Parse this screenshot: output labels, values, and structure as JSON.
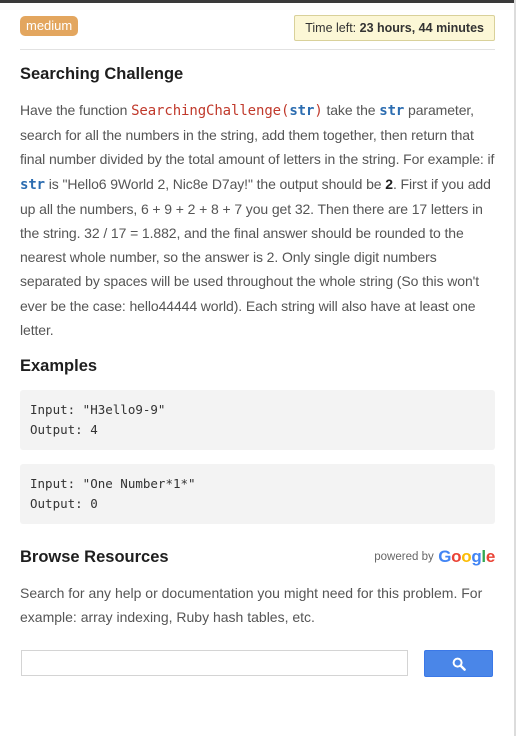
{
  "header": {
    "difficulty": "medium",
    "timer_label": "Time left:",
    "timer_value": "23 hours, 44 minutes"
  },
  "challenge": {
    "title": "Searching Challenge",
    "desc_1": "Have the function ",
    "function_name": "SearchingChallenge(",
    "function_arg": "str",
    "function_close": ")",
    "desc_2": " take the ",
    "param": "str",
    "desc_3": " parameter, search for all the numbers in the string, add them together, then return that final number divided by the total amount of letters in the string. For example: if ",
    "param_2": "str",
    "desc_4": " is \"Hello6 9World 2, Nic8e D7ay!\" the output should be ",
    "answer": "2",
    "desc_5": ". First if you add up all the numbers, 6 + 9 + 2 + 8 + 7 you get 32. Then there are 17 letters in the string. 32 / 17 = 1.882, and the final answer should be rounded to the nearest whole number, so the answer is 2. Only single digit numbers separated by spaces will be used throughout the whole string (So this won't ever be the case: hello44444 world). Each string will also have at least one letter."
  },
  "examples": {
    "title": "Examples",
    "items": [
      {
        "input": "Input: \"H3ello9-9\"",
        "output": "Output: 4"
      },
      {
        "input": "Input: \"One Number*1*\"",
        "output": "Output: 0"
      }
    ]
  },
  "resources": {
    "title": "Browse Resources",
    "powered_by": "powered by",
    "google": [
      "G",
      "o",
      "o",
      "g",
      "l",
      "e"
    ],
    "description": "Search for any help or documentation you might need for this problem. For example: array indexing, Ruby hash tables, etc.",
    "search_placeholder": "",
    "search_icon": "search-icon"
  },
  "colors": {
    "badge": "#e3a65f",
    "timer_bg": "#fcf7d6",
    "function_name": "#c0392b",
    "keyword": "#2b6cb0",
    "search_button": "#4a86e8"
  }
}
